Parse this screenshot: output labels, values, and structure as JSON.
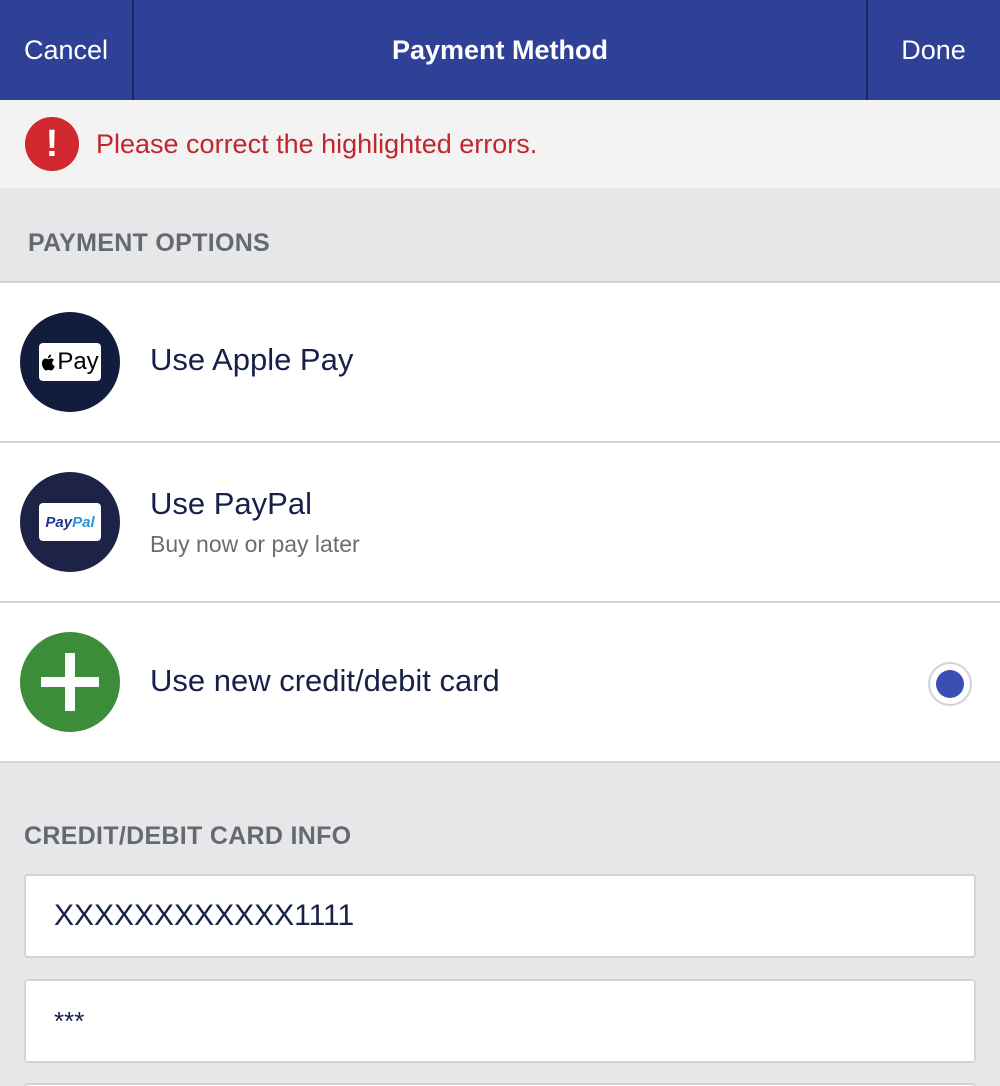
{
  "nav": {
    "cancel_label": "Cancel",
    "title": "Payment Method",
    "done_label": "Done",
    "background_color": "#2e4197"
  },
  "error": {
    "icon_glyph": "!",
    "message": "Please correct the highlighted errors.",
    "color": "#c2262b"
  },
  "payment_options": {
    "heading": "PAYMENT OPTIONS",
    "items": [
      {
        "title": "Use Apple Pay",
        "subtitle": "",
        "icon": "apple-pay-icon",
        "badge_text": "Pay",
        "selected": false
      },
      {
        "title": "Use PayPal",
        "subtitle": "Buy now or pay later",
        "icon": "paypal-icon",
        "badge_text_1": "Pay",
        "badge_text_2": "Pal",
        "selected": false
      },
      {
        "title": "Use new credit/debit card",
        "subtitle": "",
        "icon": "plus-icon",
        "selected": true
      }
    ]
  },
  "card_info": {
    "heading": "CREDIT/DEBIT CARD INFO",
    "card_number_value": "XXXXXXXXXXXX1111",
    "cvv_value": "***"
  }
}
